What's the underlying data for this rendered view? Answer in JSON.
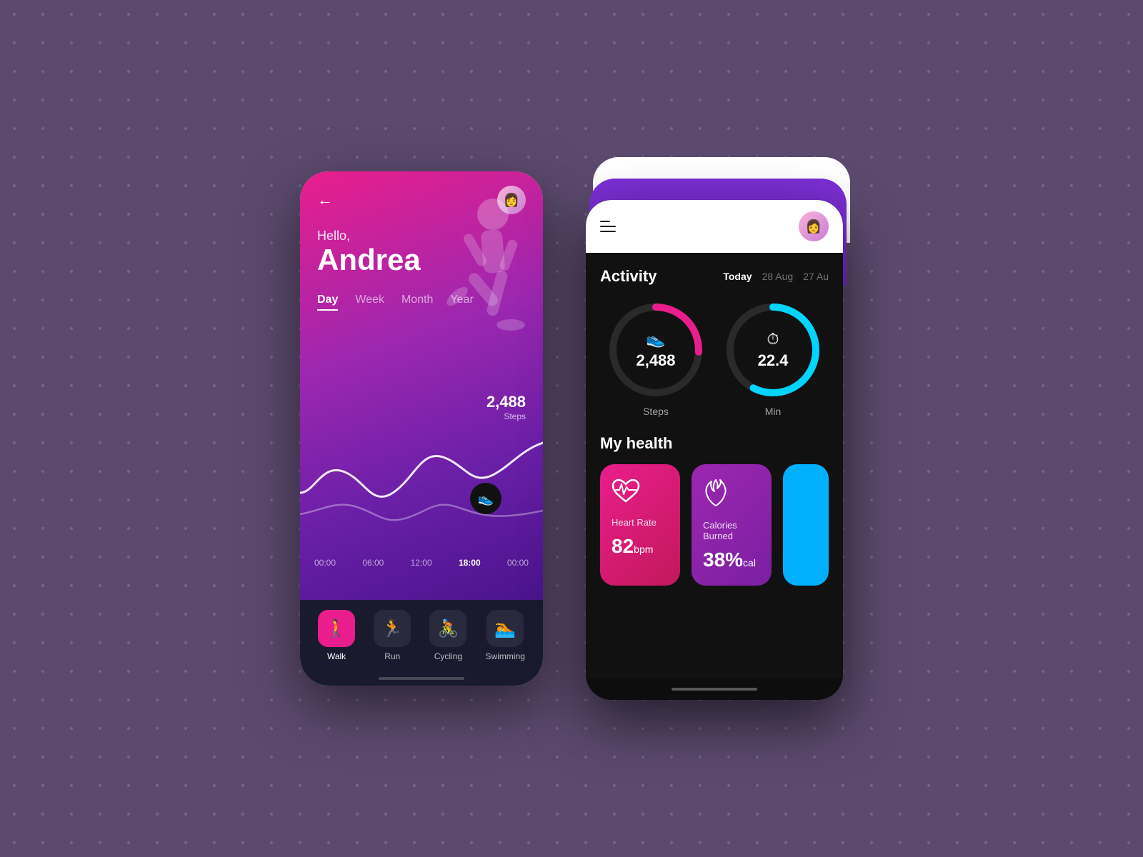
{
  "left_phone": {
    "greeting_hello": "Hello,",
    "greeting_name": "Andrea",
    "time_tabs": [
      "Day",
      "Week",
      "Month",
      "Year"
    ],
    "active_tab": "Day",
    "steps_number": "2,488",
    "steps_label": "Steps",
    "time_labels": [
      "00:00",
      "06:00",
      "12:00",
      "18:00",
      "00:00"
    ],
    "active_time": "18:00",
    "nav_items": [
      {
        "label": "Walk",
        "icon": "🚶",
        "active": true
      },
      {
        "label": "Run",
        "icon": "🏃",
        "active": false
      },
      {
        "label": "Cycling",
        "icon": "🚴",
        "active": false
      },
      {
        "label": "Swimming",
        "icon": "🏊",
        "active": false
      }
    ]
  },
  "right_phone": {
    "activity_section": {
      "title": "Activity",
      "tabs": [
        {
          "label": "Today",
          "active": true
        },
        {
          "label": "28 Aug",
          "active": false
        },
        {
          "label": "27 Au",
          "active": false
        }
      ]
    },
    "circles": [
      {
        "value": "2,488",
        "label": "Steps",
        "type": "pink"
      },
      {
        "value": "22.4",
        "label": "Min",
        "type": "cyan"
      }
    ],
    "health_section": {
      "title": "My health",
      "cards": [
        {
          "label": "Heart Rate",
          "value": "82",
          "unit": "bpm",
          "type": "pink"
        },
        {
          "label": "Calories Burned",
          "value": "38%",
          "unit": "cal",
          "type": "purple"
        }
      ]
    }
  }
}
